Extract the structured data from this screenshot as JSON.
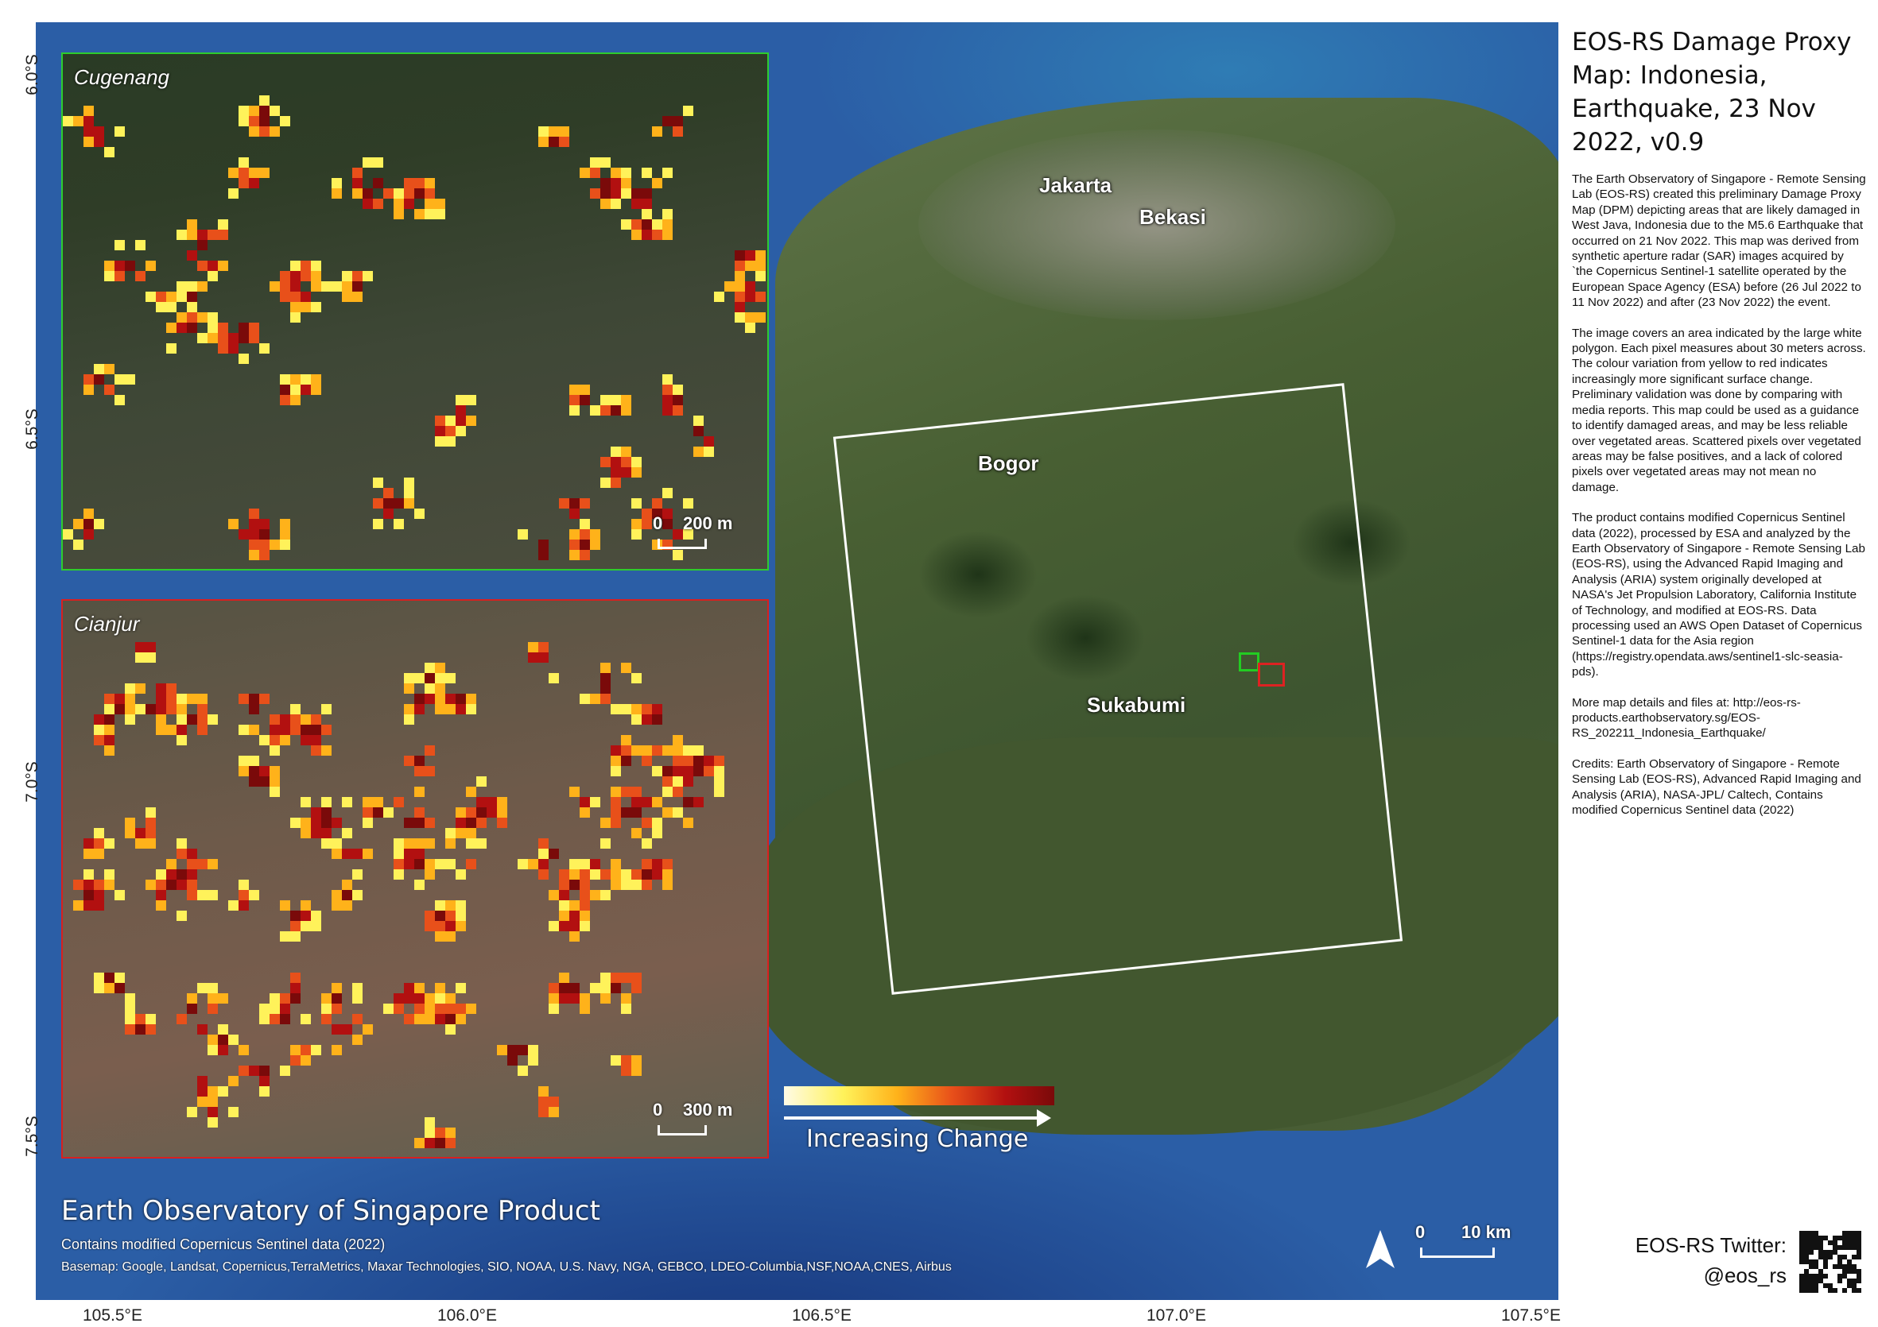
{
  "title": "EOS-RS Damage Proxy Map: Indonesia, Earthquake, 23 Nov 2022, v0.9",
  "description": [
    "The Earth Observatory of Singapore - Remote Sensing Lab (EOS-RS) created this preliminary Damage Proxy Map (DPM) depicting areas that are likely damaged in West Java, Indonesia due to the M5.6 Earthquake that occurred on 21 Nov 2022. This map was derived from synthetic aperture radar (SAR) images acquired by `the Copernicus Sentinel-1 satellite operated by the European Space Agency (ESA) before (26 Jul 2022 to 11 Nov 2022) and after (23 Nov 2022) the event.",
    "The image covers an area indicated by the large white polygon. Each pixel measures about 30 meters across. The colour variation from yellow to red indicates increasingly more significant surface change. Preliminary validation was done by comparing with media reports. This map could be used as a guidance to identify damaged areas, and may be less reliable over vegetated areas. Scattered pixels over vegetated areas may be false positives, and a lack of colored pixels over vegetated areas may not mean no damage.",
    "The product contains modified Copernicus Sentinel data (2022), processed by ESA and analyzed by the Earth Observatory of Singapore - Remote Sensing Lab (EOS-RS), using the Advanced Rapid Imaging and Analysis (ARIA) system originally developed at NASA's Jet Propulsion Laboratory, California Institute of Technology, and modified at EOS-RS. Data processing used an AWS Open Dataset of Copernicus Sentinel-1 data for the Asia region (https://registry.opendata.aws/sentinel1-slc-seasia-pds).",
    "More map details and files at: http://eos-rs-products.earthobservatory.sg/EOS-RS_202211_Indonesia_Earthquake/",
    "Credits: Earth Observatory of Singapore - Remote Sensing Lab (EOS-RS), Advanced Rapid Imaging and Analysis (ARIA), NASA-JPL/ Caltech, Contains modified Copernicus Sentinel data (2022)"
  ],
  "places": {
    "jakarta": "Jakarta",
    "bekasi": "Bekasi",
    "bogor": "Bogor",
    "sukabumi": "Sukabumi"
  },
  "insets": {
    "top": {
      "title": "Cugenang",
      "scale_start": "0",
      "scale_end": "200 m",
      "border_color": "#2ecc2e"
    },
    "bottom": {
      "title": "Cianjur",
      "scale_start": "0",
      "scale_end": "300 m",
      "border_color": "#d82020"
    }
  },
  "legend": {
    "label": "Increasing Change",
    "colors": [
      "#fffbe6",
      "#fff25a",
      "#ffb21a",
      "#e8501a",
      "#b21010",
      "#7a0a0a"
    ]
  },
  "product": {
    "title": "Earth Observatory of Singapore Product",
    "subtitle": "Contains modified Copernicus Sentinel data (2022)",
    "basemap": "Basemap: Google, Landsat, Copernicus,TerraMetrics, Maxar Technologies, SIO, NOAA, U.S. Navy, NGA, GEBCO, LDEO-Columbia,NSF,NOAA,CNES, Airbus"
  },
  "map_scale": {
    "start": "0",
    "end": "10 km"
  },
  "north_arrow": "north-arrow-icon",
  "axes": {
    "lon_ticks": [
      "105.5°E",
      "106.0°E",
      "106.5°E",
      "107.0°E",
      "107.5°E"
    ],
    "lat_ticks": [
      "6.0°S",
      "6.5°S",
      "7.0°S",
      "7.5°S"
    ]
  },
  "twitter": {
    "label": "EOS-RS Twitter:",
    "handle": "@eos_rs"
  },
  "qr_icon": "qr-code-icon"
}
